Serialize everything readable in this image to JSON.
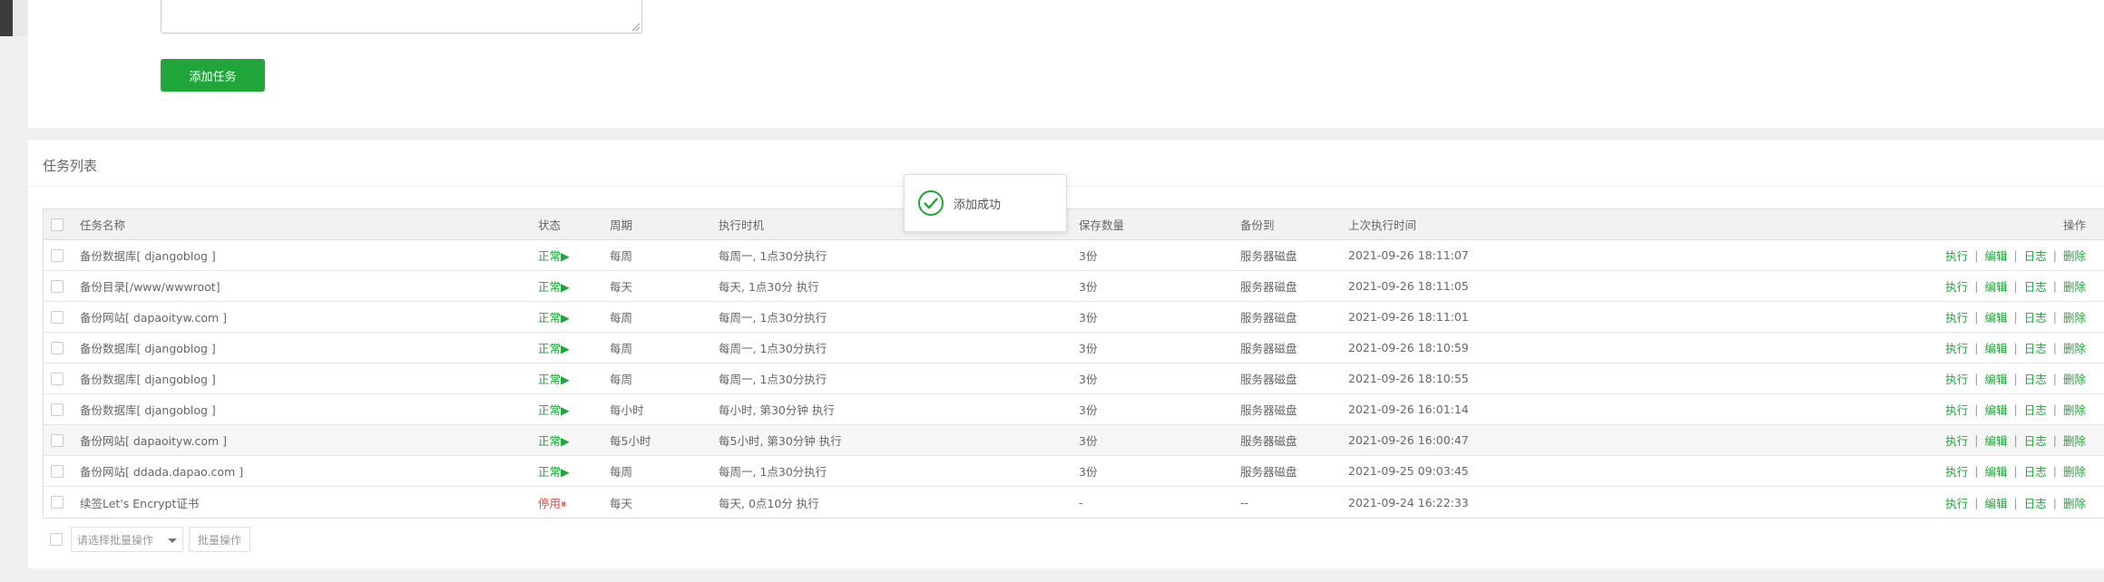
{
  "form": {
    "add_button_label": "添加任务"
  },
  "task_list": {
    "title": "任务列表",
    "headers": {
      "name": "任务名称",
      "status": "状态",
      "cycle": "周期",
      "exec_time": "执行时机",
      "keep": "保存数量",
      "backup_to": "备份到",
      "last_run": "上次执行时间",
      "ops": "操作"
    },
    "ops_labels": {
      "run": "执行",
      "edit": "编辑",
      "log": "日志",
      "delete": "删除"
    },
    "rows": [
      {
        "name": "备份数据库[ djangoblog ]",
        "status": "正常▶",
        "status_type": "ok",
        "cycle": "每周",
        "exec_time": "每周一, 1点30分执行",
        "keep": "3份",
        "backup_to": "服务器磁盘",
        "last_run": "2021-09-26 18:11:07"
      },
      {
        "name": "备份目录[/www/wwwroot]",
        "status": "正常▶",
        "status_type": "ok",
        "cycle": "每天",
        "exec_time": "每天, 1点30分 执行",
        "keep": "3份",
        "backup_to": "服务器磁盘",
        "last_run": "2021-09-26 18:11:05"
      },
      {
        "name": "备份网站[ dapaoityw.com ]",
        "status": "正常▶",
        "status_type": "ok",
        "cycle": "每周",
        "exec_time": "每周一, 1点30分执行",
        "keep": "3份",
        "backup_to": "服务器磁盘",
        "last_run": "2021-09-26 18:11:01"
      },
      {
        "name": "备份数据库[ djangoblog ]",
        "status": "正常▶",
        "status_type": "ok",
        "cycle": "每周",
        "exec_time": "每周一, 1点30分执行",
        "keep": "3份",
        "backup_to": "服务器磁盘",
        "last_run": "2021-09-26 18:10:59"
      },
      {
        "name": "备份数据库[ djangoblog ]",
        "status": "正常▶",
        "status_type": "ok",
        "cycle": "每周",
        "exec_time": "每周一, 1点30分执行",
        "keep": "3份",
        "backup_to": "服务器磁盘",
        "last_run": "2021-09-26 18:10:55"
      },
      {
        "name": "备份数据库[ djangoblog ]",
        "status": "正常▶",
        "status_type": "ok",
        "cycle": "每小时",
        "exec_time": "每小时, 第30分钟 执行",
        "keep": "3份",
        "backup_to": "服务器磁盘",
        "last_run": "2021-09-26 16:01:14"
      },
      {
        "name": "备份网站[ dapaoityw.com ]",
        "status": "正常▶",
        "status_type": "ok",
        "cycle": "每5小时",
        "exec_time": "每5小时, 第30分钟 执行",
        "keep": "3份",
        "backup_to": "服务器磁盘",
        "last_run": "2021-09-26 16:00:47"
      },
      {
        "name": "备份网站[ ddada.dapao.com ]",
        "status": "正常▶",
        "status_type": "ok",
        "cycle": "每周",
        "exec_time": "每周一, 1点30分执行",
        "keep": "3份",
        "backup_to": "服务器磁盘",
        "last_run": "2021-09-25 09:03:45"
      },
      {
        "name": "续签Let's Encrypt证书",
        "status": "停用⏸",
        "status_type": "stop",
        "cycle": "每天",
        "exec_time": "每天, 0点10分 执行",
        "keep": "-",
        "backup_to": "--",
        "last_run": "2021-09-24 16:22:33"
      }
    ],
    "batch": {
      "select_placeholder": "请选择批量操作",
      "button_label": "批量操作"
    }
  },
  "toast": {
    "message": "添加成功"
  },
  "colors": {
    "accent": "#20a53a",
    "danger": "#e24848"
  }
}
